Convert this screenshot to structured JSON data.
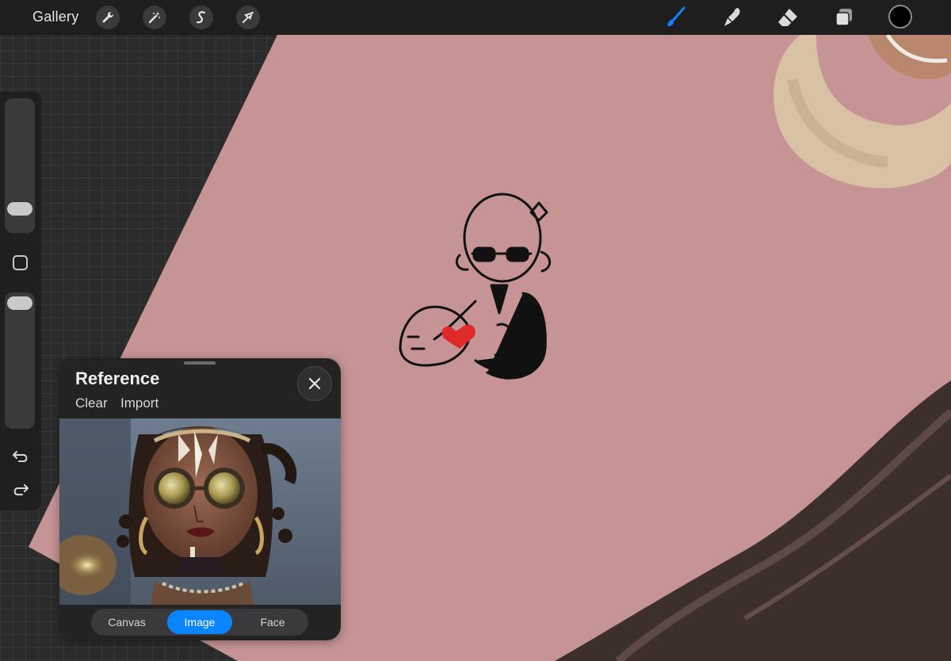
{
  "toolbar": {
    "gallery_label": "Gallery",
    "left_tools": [
      {
        "icon": "wrench-icon",
        "name": "actions"
      },
      {
        "icon": "magic-wand-icon",
        "name": "adjustments"
      },
      {
        "icon": "selection-s-icon",
        "name": "selection"
      },
      {
        "icon": "arrow-cursor-icon",
        "name": "transform"
      }
    ],
    "right_tools": [
      {
        "icon": "brush-icon",
        "name": "paint",
        "active": true
      },
      {
        "icon": "smudge-icon",
        "name": "smudge"
      },
      {
        "icon": "eraser-icon",
        "name": "eraser"
      },
      {
        "icon": "layers-icon",
        "name": "layers"
      }
    ],
    "current_color": "#000000",
    "accent_color": "#0a84ff"
  },
  "sidebar": {
    "brush_size_level": 0.82,
    "opacity_level": 0.0,
    "undo_icon": "undo-icon",
    "redo_icon": "redo-icon",
    "modifier_icon": "square-modifier-icon"
  },
  "canvas": {
    "background_color": "#c69495",
    "sketch_heart_color": "#e02a2a"
  },
  "reference_panel": {
    "title": "Reference",
    "clear_label": "Clear",
    "import_label": "Import",
    "tabs": [
      {
        "label": "Canvas",
        "active": false
      },
      {
        "label": "Image",
        "active": true
      },
      {
        "label": "Face",
        "active": false
      }
    ]
  }
}
